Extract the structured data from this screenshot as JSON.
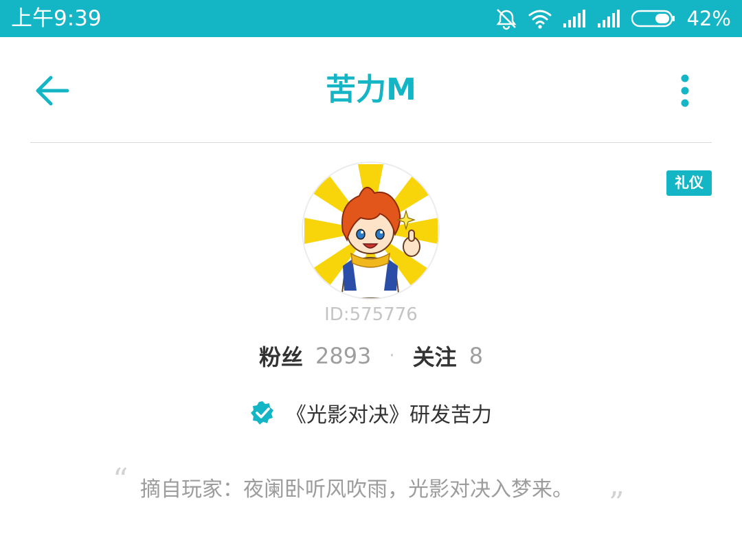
{
  "status_bar": {
    "time": "上午9:39",
    "battery": "42%",
    "icons": [
      "alarm-off-icon",
      "wifi-icon",
      "signal-icon",
      "signal-icon",
      "battery-icon"
    ],
    "background": "#14b6c6"
  },
  "header": {
    "title": "苦力M",
    "back_icon": "back-arrow-icon",
    "more_icon": "more-vertical-icon"
  },
  "profile": {
    "tag": "礼仪",
    "avatar": "avatar-cartoon-character",
    "id_text": "ID:575776",
    "fans_label": "粉丝",
    "fans_count": "2893",
    "follow_label": "关注",
    "follow_count": "8",
    "stat_separator": "·",
    "verified_icon": "verified-check-icon",
    "verified_text": "《光影对决》研发苦力",
    "quote_open": "“",
    "quote": "摘自玩家：夜阑卧听风吹雨，光影对决入梦来。",
    "quote_close": "”"
  },
  "colors": {
    "accent": "#14b6c6",
    "text_primary": "#333333",
    "text_secondary": "#9e9e9e"
  }
}
